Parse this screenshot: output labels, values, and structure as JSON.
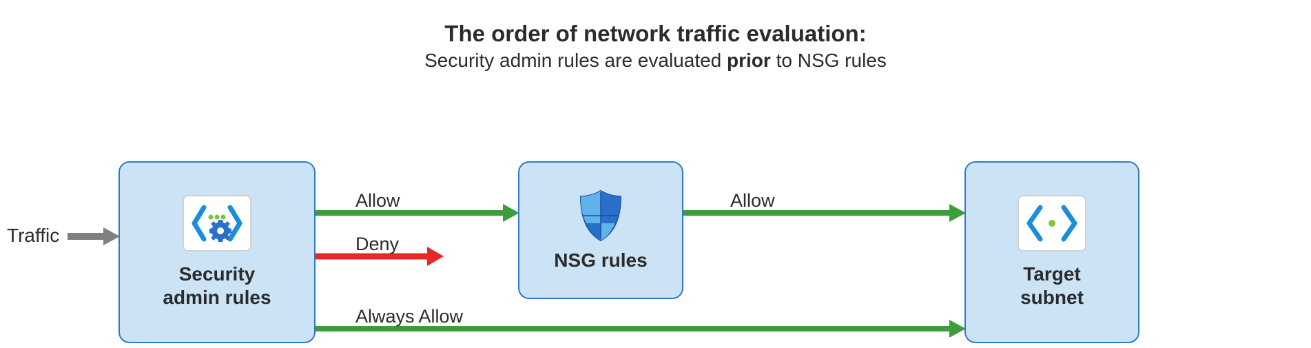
{
  "header": {
    "title": "The order of network traffic evaluation:",
    "subtitle_prefix": "Security admin rules are evaluated ",
    "subtitle_bold": "prior",
    "subtitle_suffix": " to NSG rules"
  },
  "traffic_label": "Traffic",
  "boxes": {
    "security": "Security\nadmin rules",
    "nsg": "NSG rules",
    "target": "Target\nsubnet"
  },
  "arrows": {
    "allow1": "Allow",
    "deny": "Deny",
    "always_allow": "Always Allow",
    "allow2": "Allow"
  },
  "colors": {
    "allow": "#3b9e3b",
    "deny": "#e82727",
    "traffic": "#808080",
    "box_bg": "#cce3f6",
    "box_border": "#2d7bc5"
  }
}
